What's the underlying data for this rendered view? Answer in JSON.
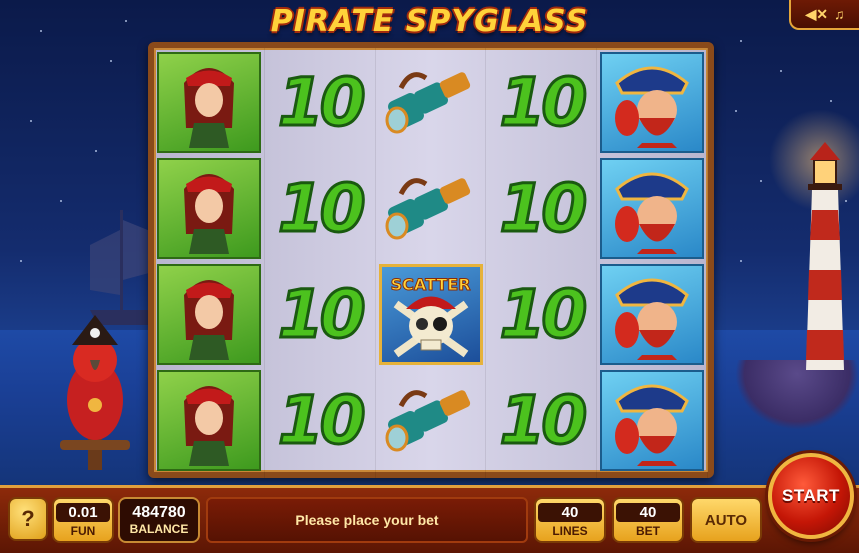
{
  "game": {
    "title": "PIRATE SPYGLASS"
  },
  "sound_panel": {
    "mute_icon": "speaker-mute-icon",
    "music_icon": "music-note-icon"
  },
  "reels": [
    [
      "lady",
      "lady",
      "lady",
      "lady"
    ],
    [
      "ten",
      "ten",
      "ten",
      "ten"
    ],
    [
      "spyglass",
      "spyglass",
      "scatter",
      "spyglass"
    ],
    [
      "ten",
      "ten",
      "ten",
      "ten"
    ],
    [
      "captain",
      "captain",
      "captain",
      "captain"
    ]
  ],
  "symbols": {
    "ten_text": "10",
    "scatter_text": "SCATTER"
  },
  "controls": {
    "help_label": "?",
    "denomination_value": "0.01",
    "denomination_caption": "FUN",
    "balance_value": "484780",
    "balance_caption": "BALANCE",
    "message": "Please place your bet",
    "lines_value": "40",
    "lines_caption": "LINES",
    "bet_value": "40",
    "bet_caption": "BET",
    "auto_label": "AUTO",
    "start_label": "START"
  }
}
